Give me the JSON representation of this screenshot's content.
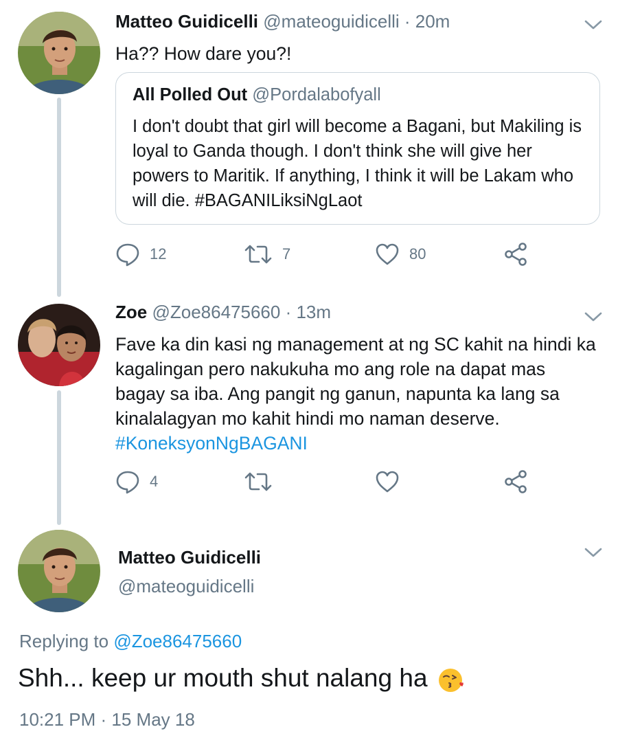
{
  "colors": {
    "accent": "#1b95e0",
    "secondary_text": "#657786",
    "thread_line": "#ccd6dd"
  },
  "tweets": [
    {
      "name": "Matteo Guidicelli",
      "meta": "@mateoguidicelli · 20m",
      "text": "Ha?? How dare you?!",
      "quote": {
        "name": "All Polled Out",
        "meta": "@Pordalabofyall",
        "text": "I don't doubt that girl will become a Bagani, but Makiling is loyal to Ganda though.  I don't think she will give her powers to Maritik.  If anything, I think it will be Lakam who will die. #BAGANILiksiNgLaot"
      },
      "actions": {
        "replies": "12",
        "retweets": "7",
        "likes": "80"
      }
    },
    {
      "name": "Zoe",
      "meta": "@Zoe86475660 · 13m",
      "text": "Fave ka din kasi ng management at ng SC kahit na hindi ka kagalingan pero nakukuha mo ang role na dapat mas bagay sa iba. Ang pangit ng ganun, napunta ka lang sa kinalalagyan mo kahit hindi mo naman deserve.",
      "hashtag": "#KoneksyonNgBAGANI",
      "actions": {
        "replies": "4"
      }
    }
  ],
  "main_tweet": {
    "name": "Matteo Guidicelli",
    "handle": "@mateoguidicelli",
    "replying_prefix": "Replying to",
    "replying_to": "@Zoe86475660",
    "text": "Shh... keep ur mouth shut nalang ha",
    "emoji": "face-throwing-kiss",
    "timestamp": "10:21 PM · 15 May 18"
  },
  "icons": [
    "reply-icon",
    "retweet-icon",
    "like-icon",
    "share-icon",
    "chevron-down-icon"
  ]
}
